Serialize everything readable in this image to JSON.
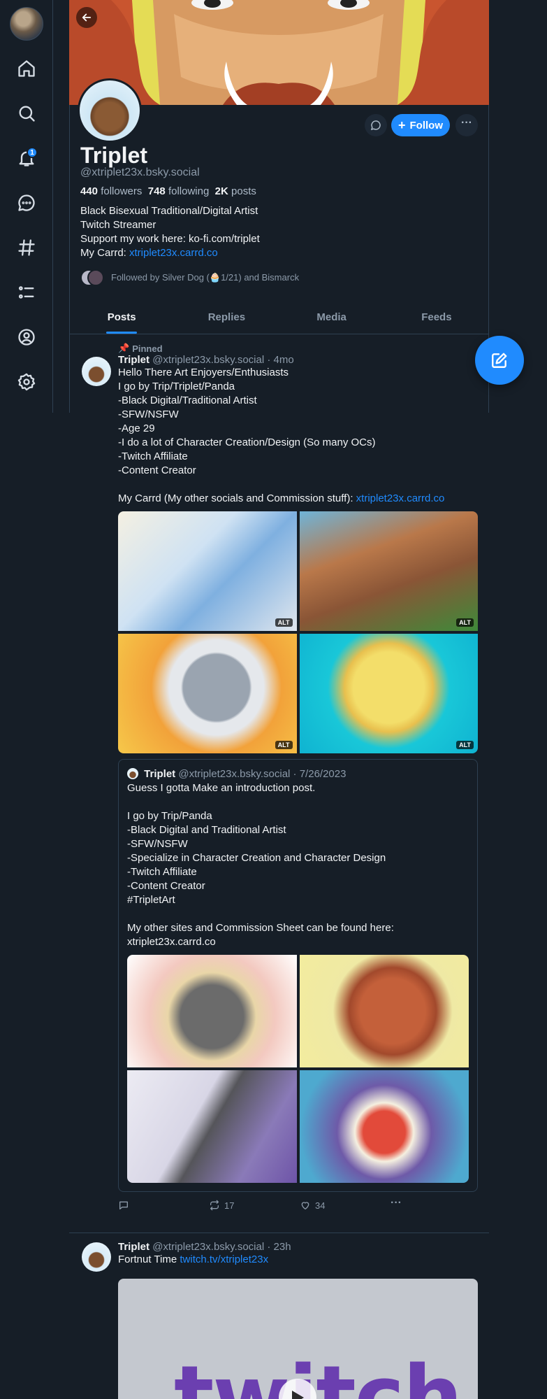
{
  "rail": {
    "nav": [
      "home",
      "search",
      "notifications",
      "chat",
      "feeds",
      "lists",
      "profile",
      "settings"
    ],
    "notifications_badge": "1"
  },
  "profile": {
    "name": "Triplet",
    "handle": "@xtriplet23x.bsky.social",
    "followers_count": "440",
    "followers_label": "followers",
    "following_count": "748",
    "following_label": "following",
    "posts_count": "2K",
    "posts_label": "posts",
    "follow_label": "Follow",
    "bio": {
      "line1": "Black Bisexual Traditional/Digital Artist",
      "line2": "Twitch Streamer",
      "line3": "Support my work here: ko-fi.com/triplet",
      "line4_prefix": "My Carrd: ",
      "line4_link": "xtriplet23x.carrd.co"
    },
    "followed_by": "Followed by Silver Dog (🧁1/21) and Bismarck"
  },
  "tabs": [
    "Posts",
    "Replies",
    "Media",
    "Feeds"
  ],
  "posts": [
    {
      "pinned_label": "Pinned",
      "author": "Triplet",
      "handle": "@xtriplet23x.bsky.social",
      "time": "4mo",
      "text": "Hello There Art Enjoyers/Enthusiasts\nI go by Trip/Triplet/Panda\n-Black Digital/Traditional Artist\n-SFW/NSFW\n-Age 29\n-I do a lot of Character Creation/Design (So many OCs)\n-Twitch Affiliate\n-Content Creator\n\nMy Carrd (My other socials and Commission stuff): ",
      "link": "xtriplet23x.carrd.co",
      "image_alt_label": "ALT",
      "quote": {
        "author": "Triplet",
        "handle": "@xtriplet23x.bsky.social",
        "date": "7/26/2023",
        "text": "Guess I gotta Make an introduction post.\n\nI go by Trip/Panda\n-Black Digital and Traditional Artist\n-SFW/NSFW\n-Specialize in Character Creation and Character Design\n-Twitch Affiliate\n-Content Creator\n#TripletArt\n\nMy other sites and Commission Sheet can be found here:\nxtriplet23x.carrd.co"
      },
      "reposts": "17",
      "likes": "34"
    },
    {
      "author": "Triplet",
      "handle": "@xtriplet23x.bsky.social",
      "time": "23h",
      "text_prefix": "Fortnut Time ",
      "link": "twitch.tv/xtriplet23x",
      "embed_word": "twitch"
    }
  ],
  "colors": {
    "background": "#161e27",
    "accent": "#208bfe",
    "border": "#2e4052",
    "muted": "#8c9aa9"
  }
}
